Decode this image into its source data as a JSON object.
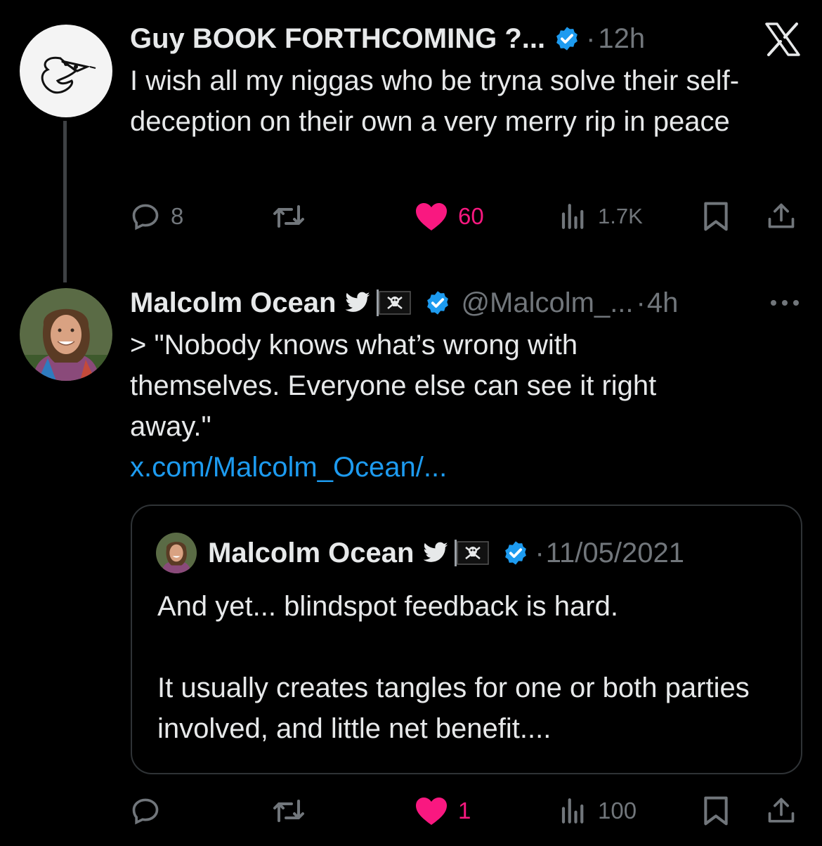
{
  "tweet1": {
    "author_name": "Guy BOOK FORTHCOMING ?...",
    "time": "12h",
    "separator": "·",
    "text": "I wish all my niggas who be tryna solve their self-deception on their own a very merry rip in peace",
    "stats": {
      "replies": "8",
      "likes": "60",
      "views": "1.7K"
    }
  },
  "tweet2": {
    "author_name": "Malcolm Ocean",
    "handle": "@Malcolm_...",
    "time": "4h",
    "separator": "·",
    "text": "> \"Nobody knows what’s wrong with themselves. Everyone else can see it right away.\"",
    "link": "x.com/Malcolm_Ocean/...",
    "quote": {
      "author_name": "Malcolm Ocean",
      "separator": "·",
      "date": "11/05/2021",
      "para1": "And yet... blindspot feedback is hard.",
      "para2": "It usually creates tangles for one or both parties involved, and little net benefit...."
    },
    "stats": {
      "likes": "1",
      "views": "100"
    }
  },
  "colors": {
    "background": "#000000",
    "text": "#e7e9ea",
    "muted": "#71767b",
    "verified": "#1d9bf0",
    "like": "#f91880",
    "border": "#2f3336"
  },
  "icons": [
    "x-logo-icon",
    "verified-badge-icon",
    "bird-icon",
    "pirate-flag-icon",
    "more-icon",
    "reply-icon",
    "retweet-icon",
    "heart-icon",
    "views-icon",
    "bookmark-icon",
    "share-icon"
  ]
}
